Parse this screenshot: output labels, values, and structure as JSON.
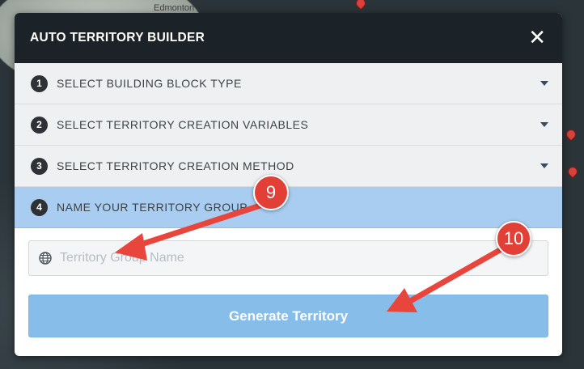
{
  "map": {
    "city_label": "Edmonton"
  },
  "modal": {
    "title": "AUTO TERRITORY BUILDER",
    "close_glyph": "✕"
  },
  "steps": [
    {
      "number": "1",
      "label": "SELECT BUILDING BLOCK TYPE",
      "active": false
    },
    {
      "number": "2",
      "label": "SELECT TERRITORY CREATION VARIABLES",
      "active": false
    },
    {
      "number": "3",
      "label": "SELECT TERRITORY CREATION METHOD",
      "active": false
    },
    {
      "number": "4",
      "label": "NAME YOUR TERRITORY GROUP",
      "active": true
    }
  ],
  "form": {
    "name_placeholder": "Territory Group Name",
    "name_value": "",
    "input_icon": "globe-icon",
    "generate_label": "Generate Territory"
  },
  "annotations": [
    {
      "label": "9"
    },
    {
      "label": "10"
    }
  ],
  "colors": {
    "header_bg": "#1c2328",
    "active_step_bg": "#a8cdf0",
    "button_bg": "#86bde9",
    "callout_red": "#e23f37"
  }
}
